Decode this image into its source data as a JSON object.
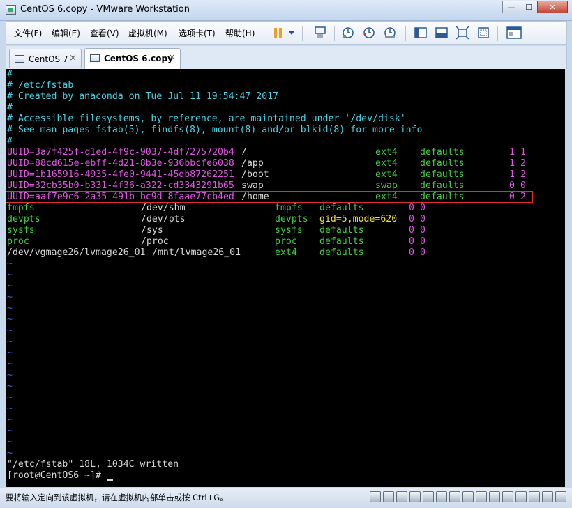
{
  "window": {
    "title": "CentOS 6.copy - VMware Workstation",
    "minimize_glyph": "—",
    "maximize_glyph": "☐",
    "close_glyph": "✕"
  },
  "menu": {
    "items": [
      "文件(F)",
      "编辑(E)",
      "查看(V)",
      "虚拟机(M)",
      "选项卡(T)",
      "帮助(H)"
    ]
  },
  "toolbar": {
    "icons": [
      "pause-icon",
      "dropdown-icon",
      "send-ctrl-alt-del-icon",
      "snapshot-icon",
      "revert-snapshot-icon",
      "snapshot-manager-icon",
      "sidebar-icon",
      "console-view-icon",
      "fullscreen-icon",
      "unity-icon",
      "thumbnail-icon"
    ]
  },
  "tabs": [
    {
      "label": "CentOS 7",
      "active": false,
      "close": "×"
    },
    {
      "label": "CentOS 6.copy",
      "active": true,
      "close": "×"
    }
  ],
  "console": {
    "comment_lines": [
      "#",
      "# /etc/fstab",
      "# Created by anaconda on Tue Jul 11 19:54:47 2017",
      "#",
      "# Accessible filesystems, by reference, are maintained under '/dev/disk'",
      "# See man pages fstab(5), findfs(8), mount(8) and/or blkid(8) for more info",
      "#"
    ],
    "uuid_rows": [
      {
        "uuid": "3a7f425f-d1ed-4f9c-9037-4df7275720b4",
        "mount": "/",
        "fs": "ext4",
        "opts": "defaults",
        "d1": "1",
        "d2": "1"
      },
      {
        "uuid": "88cd615e-ebff-4d21-8b3e-936bbcfe6038",
        "mount": "/app",
        "fs": "ext4",
        "opts": "defaults",
        "d1": "1",
        "d2": "2"
      },
      {
        "uuid": "1b165916-4935-4fe0-9441-45db87262251",
        "mount": "/boot",
        "fs": "ext4",
        "opts": "defaults",
        "d1": "1",
        "d2": "2"
      },
      {
        "uuid": "32cb35b0-b331-4f36-a322-cd3343291b65",
        "mount": "swap",
        "fs": "swap",
        "opts": "defaults",
        "d1": "0",
        "d2": "0"
      },
      {
        "uuid": "aaf7e9c6-2a35-491b-bc9d-8faae77cb4ed",
        "mount": "/home",
        "fs": "ext4",
        "opts": "defaults",
        "d1": "0",
        "d2": "2"
      }
    ],
    "uuid_key": "UUID=",
    "other_rows": [
      {
        "dev": "tmpfs",
        "mount": "/dev/shm",
        "fs": "tmpfs",
        "opts": "defaults",
        "d1": "0",
        "d2": "0"
      },
      {
        "dev": "devpts",
        "mount": "/dev/pts",
        "fs": "devpts",
        "opts": "gid=5,mode=620",
        "d1": "0",
        "d2": "0"
      },
      {
        "dev": "sysfs",
        "mount": "/sys",
        "fs": "sysfs",
        "opts": "defaults",
        "d1": "0",
        "d2": "0"
      },
      {
        "dev": "proc",
        "mount": "/proc",
        "fs": "proc",
        "opts": "defaults",
        "d1": "0",
        "d2": "0"
      }
    ],
    "lvm_row": {
      "dev": "/dev/vgmage26/lvmage26_01",
      "mount": "/mnt/lvmage26_01",
      "fs": "ext4",
      "opts": "defaults",
      "d1": "0",
      "d2": "0"
    },
    "tilde": "~",
    "tilde_count": 18,
    "written_msg": "\"/etc/fstab\" 18L, 1034C written",
    "prompt": "[root@CentOS6 ~]# "
  },
  "status": {
    "text": "要将输入定向到该虚拟机，请在虚拟机内部单击或按 Ctrl+G。"
  },
  "colors": {
    "comment": "#48d2e6",
    "uuid": "#e055e0",
    "fs_type": "#3fd03f",
    "tilde": "#3a63e0",
    "highlight_box": "#e0302a"
  }
}
